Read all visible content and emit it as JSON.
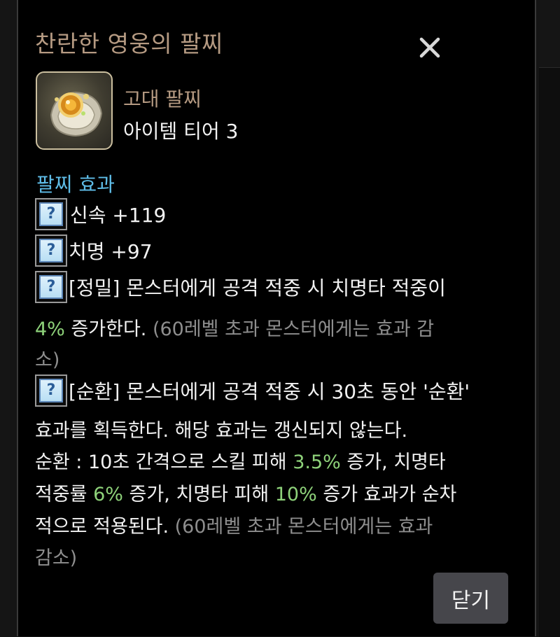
{
  "dialog": {
    "title": "찬란한 영웅의 팔찌",
    "close_button_label": "닫기"
  },
  "item": {
    "category": "고대 팔찌",
    "tier": "아이템 티어 3",
    "icon": "bracelet-icon"
  },
  "effects": {
    "heading": "팔찌 효과",
    "icon_glyph": "?",
    "stat1": " 신속 +119",
    "stat2": "치명 +97",
    "precision": {
      "line1": "[정밀] 몬스터에게 공격 적중 시 치명타 적중이",
      "line2_value": "4%",
      "line2_text": " 증가한다. ",
      "line2_note": "(60레벨 초과 몬스터에게는 효과 감",
      "line3_note": "소)"
    },
    "cycle": {
      "line1": "[순환] 몬스터에게 공격 적중 시 30초 동안 '순환'",
      "line2": "효과를 획득한다. 해당 효과는 갱신되지 않는다.",
      "line3_pre": "순환 : 10초 간격으로 스킬 피해 ",
      "line3_value": "3.5%",
      "line3_post": " 증가, 치명타",
      "line4_pre": "적중률 ",
      "line4_value1": "6%",
      "line4_mid": " 증가, 치명타 피해 ",
      "line4_value2": "10%",
      "line4_post": " 증가 효과가 순차",
      "line5_text": "적으로 적용된다. ",
      "line5_note": "(60레벨 초과 몬스터에게는 효과",
      "line6_note": "감소)"
    }
  },
  "colors": {
    "title": "#b59a82",
    "heading": "#5fbde8",
    "highlight": "#8ed27a",
    "note": "#8e8e8e"
  }
}
